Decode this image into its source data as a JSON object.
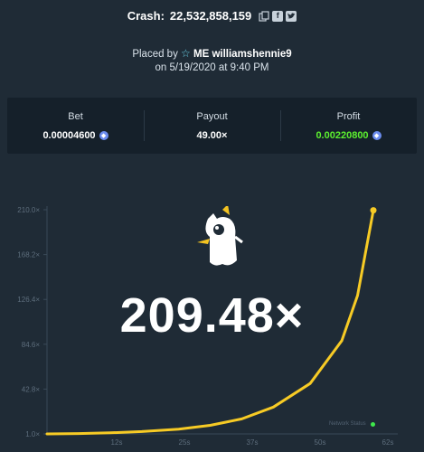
{
  "header": {
    "crash_label": "Crash:",
    "crash_id": "22,532,858,159",
    "placed_prefix": "Placed by",
    "username": "ME williamshennie9",
    "placed_on": "on 5/19/2020 at 9:40 PM"
  },
  "stats": {
    "bet_label": "Bet",
    "bet_value": "0.00004600",
    "payout_label": "Payout",
    "payout_value": "49.00×",
    "profit_label": "Profit",
    "profit_value": "0.00220800"
  },
  "multiplier": "209.48×",
  "network_status": "Network Status",
  "colors": {
    "background": "#1f2b36",
    "panel": "#15202a",
    "curve": "#f7cb25",
    "profit": "#5cf02f",
    "status_ok": "#3ee84b"
  },
  "icons": [
    "copy-icon",
    "facebook-icon",
    "twitter-icon",
    "star-icon",
    "eth-icon"
  ],
  "chart_data": {
    "type": "line",
    "title": "",
    "xlabel": "",
    "ylabel": "",
    "x_ticks": [
      "12s",
      "25s",
      "37s",
      "50s",
      "62s"
    ],
    "y_ticks": [
      "1.0×",
      "42.8×",
      "84.6×",
      "126.4×",
      "168.2×",
      "210.0×"
    ],
    "xlim": [
      0,
      62
    ],
    "ylim": [
      1.0,
      210.0
    ],
    "series": [
      {
        "x": [
          0,
          6,
          12,
          18,
          25,
          31,
          37,
          43,
          50,
          56,
          59,
          62
        ],
        "values": [
          1.0,
          1.3,
          2.0,
          3.2,
          5.5,
          9.0,
          15.0,
          26.0,
          48.0,
          88.0,
          130.0,
          209.48
        ]
      }
    ],
    "grid": false,
    "legend": "none"
  }
}
